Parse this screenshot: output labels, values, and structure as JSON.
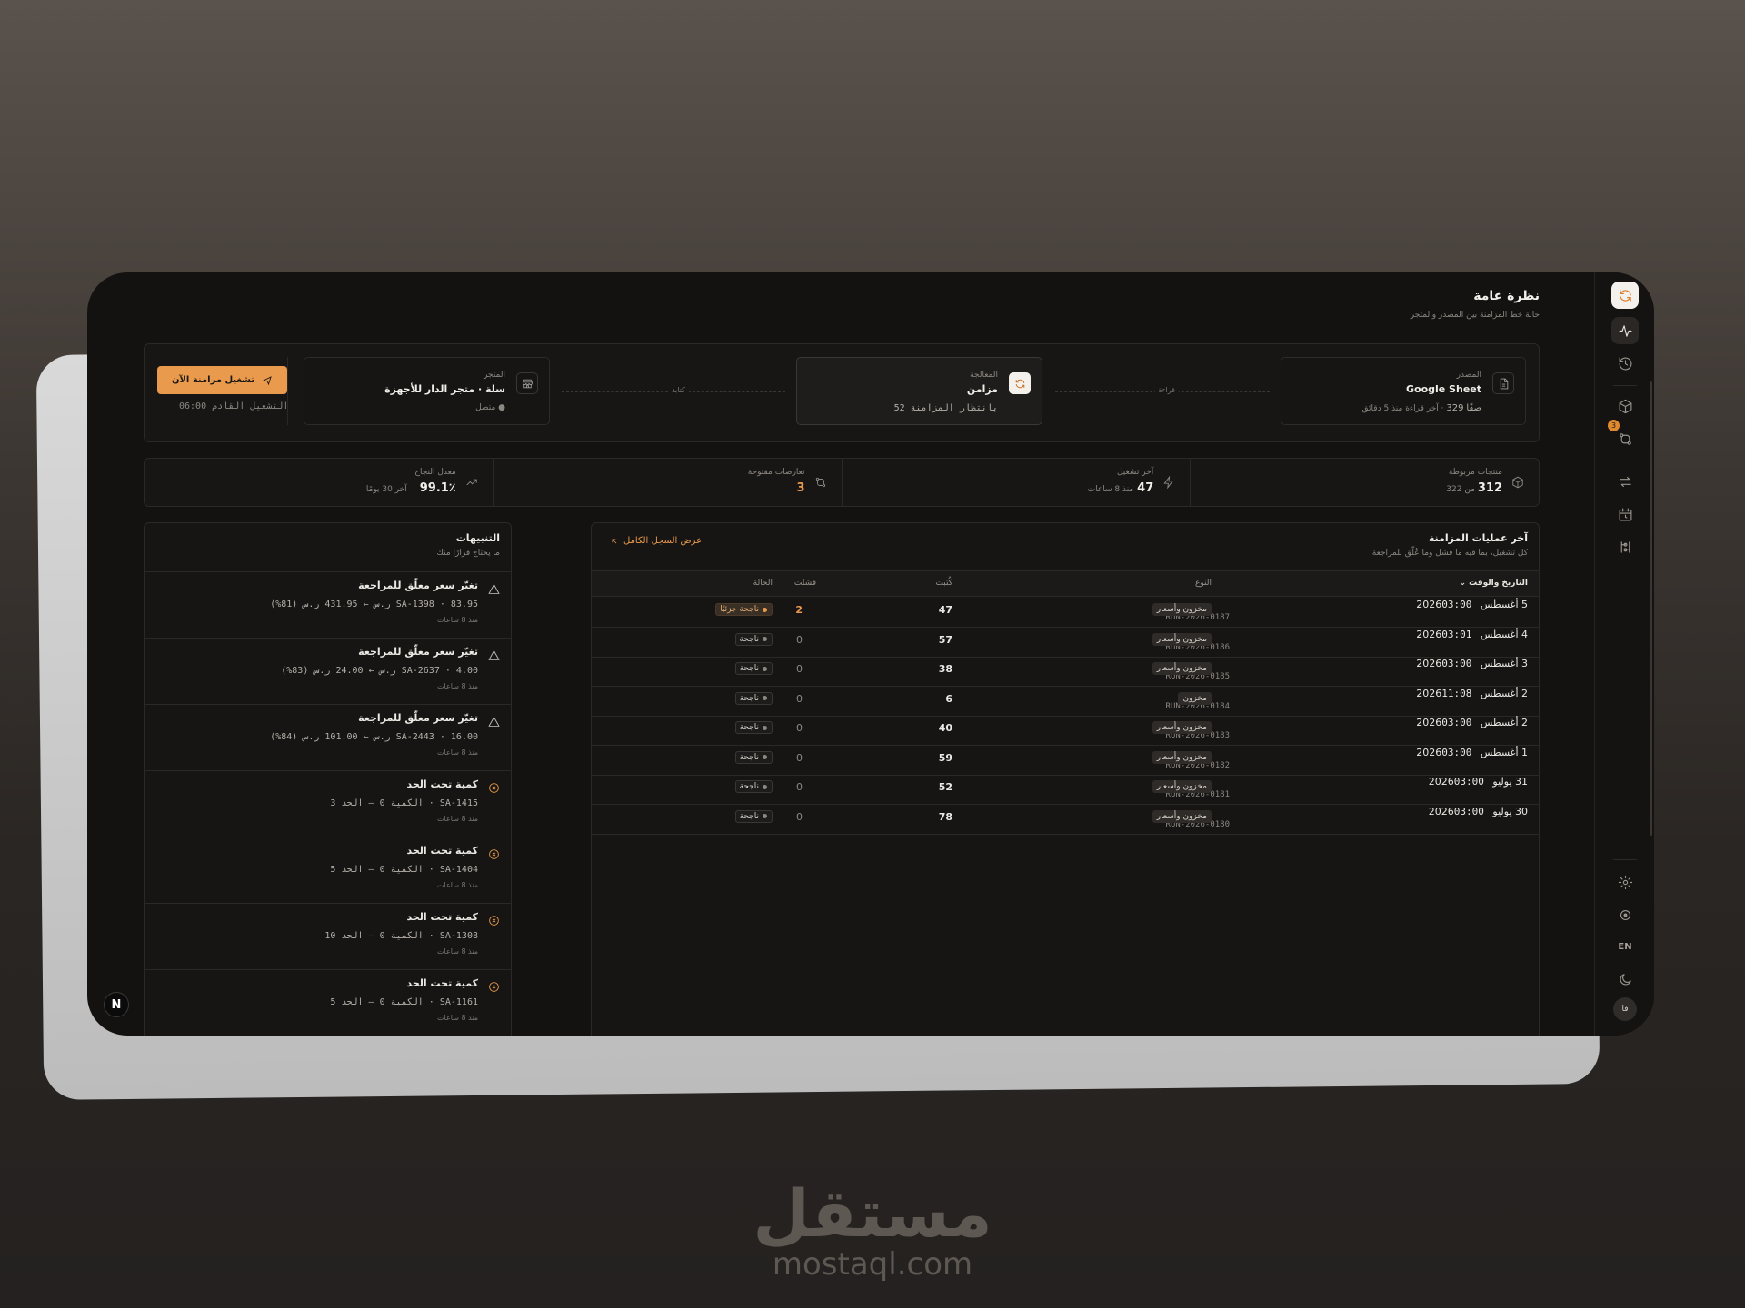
{
  "page": {
    "title": "نظرة عامة",
    "subtitle": "حالة خط المزامنة بين المصدر والمتجر"
  },
  "pipeline": {
    "source": {
      "label": "المصدر",
      "value": "Google Sheet",
      "rows": "329",
      "rows_unit": "صفًا",
      "meta": "آخر قراءة منذ 5 دقائق"
    },
    "read_label": "قراءة",
    "processing": {
      "label": "المعالجة",
      "value": "مزامن",
      "meta": "بانتظار المزامنة 52"
    },
    "write_label": "كتابة",
    "store": {
      "label": "المتجر",
      "value": "سلة · متجر الدار للأجهزة",
      "status": "متصل"
    },
    "run_button": "تشغيل مزامنة الآن",
    "next_run": "التشغيل القادم 06:00"
  },
  "stats": [
    {
      "label": "منتجات مربوطة",
      "value": "312",
      "meta": "من 322",
      "icon": "box-icon"
    },
    {
      "label": "آخر تشغيل",
      "value": "47",
      "meta": "منذ 8 ساعات",
      "icon": "bolt-icon"
    },
    {
      "label": "تعارضات مفتوحة",
      "value": "3",
      "meta": "",
      "icon": "conflict-icon"
    },
    {
      "label": "معدل النجاح",
      "value": "99.1٪",
      "meta": "آخر 30 يومًا",
      "icon": "trend-icon"
    }
  ],
  "runs": {
    "title": "آخر عمليات المزامنة",
    "subtitle": "كل تشغيل، بما فيه ما فشل وما عُلّق للمراجعة",
    "view_all": "عرض السجل الكامل",
    "columns": {
      "date": "التاريخ والوقت",
      "type": "النوع",
      "written": "كُتبت",
      "failed": "فشلت",
      "status": "الحالة"
    },
    "rows": [
      {
        "date": "5 أغسطس 2026",
        "time": "03:00",
        "run": "RUN-2026-0187",
        "type": "مخزون وأسعار",
        "written": "47",
        "failed": "2",
        "status": "ناجحة جزئيًا",
        "partial": true
      },
      {
        "date": "4 أغسطس 2026",
        "time": "03:01",
        "run": "RUN-2026-0186",
        "type": "مخزون وأسعار",
        "written": "57",
        "failed": "0",
        "status": "ناجحة",
        "partial": false
      },
      {
        "date": "3 أغسطس 2026",
        "time": "03:00",
        "run": "RUN-2026-0185",
        "type": "مخزون وأسعار",
        "written": "38",
        "failed": "0",
        "status": "ناجحة",
        "partial": false
      },
      {
        "date": "2 أغسطس 2026",
        "time": "11:08",
        "run": "RUN-2026-0184",
        "type": "مخزون",
        "written": "6",
        "failed": "0",
        "status": "ناجحة",
        "partial": false
      },
      {
        "date": "2 أغسطس 2026",
        "time": "03:00",
        "run": "RUN-2026-0183",
        "type": "مخزون وأسعار",
        "written": "40",
        "failed": "0",
        "status": "ناجحة",
        "partial": false
      },
      {
        "date": "1 أغسطس 2026",
        "time": "03:00",
        "run": "RUN-2026-0182",
        "type": "مخزون وأسعار",
        "written": "59",
        "failed": "0",
        "status": "ناجحة",
        "partial": false
      },
      {
        "date": "31 يوليو 2026",
        "time": "03:00",
        "run": "RUN-2026-0181",
        "type": "مخزون وأسعار",
        "written": "52",
        "failed": "0",
        "status": "ناجحة",
        "partial": false
      },
      {
        "date": "30 يوليو 2026",
        "time": "03:00",
        "run": "RUN-2026-0180",
        "type": "مخزون وأسعار",
        "written": "78",
        "failed": "0",
        "status": "ناجحة",
        "partial": false
      }
    ]
  },
  "alerts": {
    "title": "التنبيهات",
    "subtitle": "ما يحتاج قرارًا منك",
    "items": [
      {
        "kind": "warn",
        "title": "تغيّر سعر معلّق للمراجعة",
        "detail": "SA-1398 · 83.95 ر.س ← 431.95 ر.س (81%)",
        "time": "منذ 8 ساعات"
      },
      {
        "kind": "warn",
        "title": "تغيّر سعر معلّق للمراجعة",
        "detail": "SA-2637 · 4.00 ر.س ← 24.00 ر.س (83%)",
        "time": "منذ 8 ساعات"
      },
      {
        "kind": "warn",
        "title": "تغيّر سعر معلّق للمراجعة",
        "detail": "SA-2443 · 16.00 ر.س ← 101.00 ر.س (84%)",
        "time": "منذ 8 ساعات"
      },
      {
        "kind": "stock",
        "title": "كمية تحت الحد",
        "detail": "SA-1415 · الكمية 0 — الحد 3",
        "time": "منذ 8 ساعات"
      },
      {
        "kind": "stock",
        "title": "كمية تحت الحد",
        "detail": "SA-1404 · الكمية 0 — الحد 5",
        "time": "منذ 8 ساعات"
      },
      {
        "kind": "stock",
        "title": "كمية تحت الحد",
        "detail": "SA-1308 · الكمية 0 — الحد 10",
        "time": "منذ 8 ساعات"
      },
      {
        "kind": "stock",
        "title": "كمية تحت الحد",
        "detail": "SA-1161 · الكمية 0 — الحد 5",
        "time": "منذ 8 ساعات"
      }
    ]
  },
  "rail": {
    "notif_count": "3",
    "lang": "EN",
    "avatar": "فا"
  },
  "badge": "N",
  "watermark": {
    "arabic": "مستقل",
    "latin": "mostaql.com"
  },
  "colors": {
    "accent": "#e99a4c",
    "background": "#131211"
  }
}
